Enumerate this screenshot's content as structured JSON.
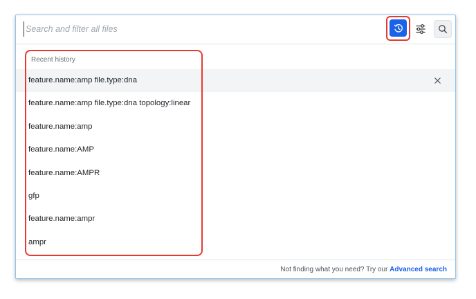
{
  "search": {
    "placeholder": "Search and filter all files"
  },
  "toolbar": {
    "history_icon": "history-clock-icon",
    "filter_icon": "sliders-icon",
    "search_icon": "search-icon",
    "accent_color": "#1a62e8",
    "annotation_color": "#e53b2f"
  },
  "history": {
    "header": "Recent history",
    "items": [
      {
        "label": "feature.name:amp file.type:dna"
      },
      {
        "label": "feature.name:amp file.type:dna topology:linear"
      },
      {
        "label": "feature.name:amp"
      },
      {
        "label": "feature.name:AMP"
      },
      {
        "label": "feature.name:AMPR"
      },
      {
        "label": "gfp"
      },
      {
        "label": "feature.name:ampr"
      },
      {
        "label": "ampr"
      }
    ],
    "remove_icon": "close-icon"
  },
  "footer": {
    "prompt": "Not finding what you need? Try our ",
    "link_label": "Advanced search"
  }
}
